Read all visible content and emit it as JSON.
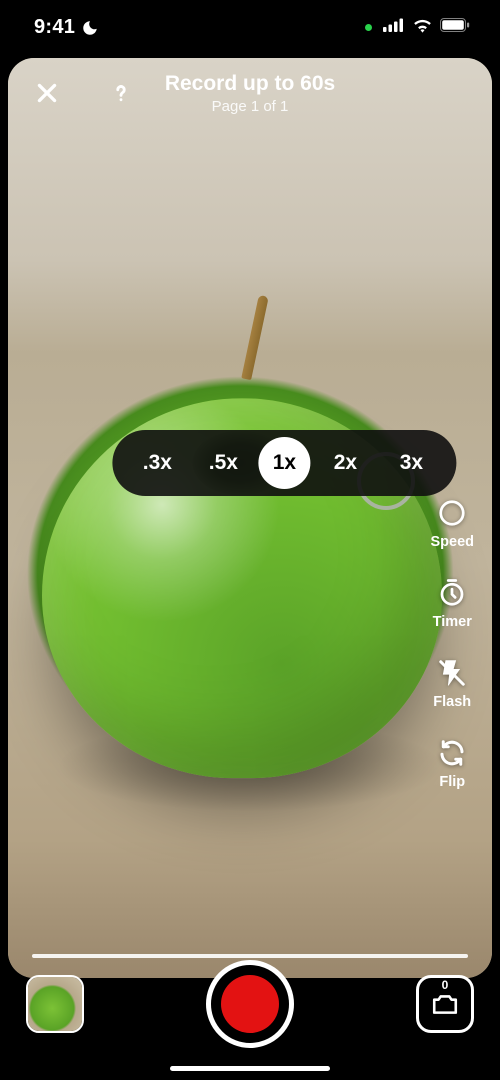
{
  "statusBar": {
    "time": "9:41"
  },
  "header": {
    "title": "Record up to 60s",
    "subtitle": "Page 1 of 1"
  },
  "zoom": {
    "options": [
      ".3x",
      ".5x",
      "1x",
      "2x",
      "3x"
    ],
    "selectedIndex": 2
  },
  "tools": {
    "speed": "Speed",
    "timer": "Timer",
    "flash": "Flash",
    "flip": "Flip"
  },
  "gallery": {
    "count": "0"
  }
}
